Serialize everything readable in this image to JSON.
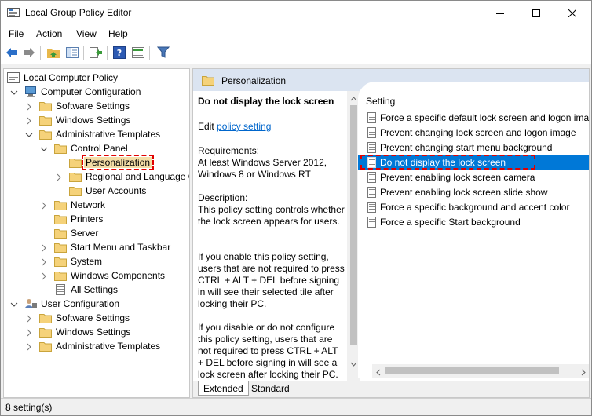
{
  "window": {
    "title": "Local Group Policy Editor",
    "controls": [
      "minimize-icon",
      "maximize-icon",
      "close-icon"
    ]
  },
  "menu": [
    "File",
    "Action",
    "View",
    "Help"
  ],
  "toolbar": {
    "icons": [
      "back-arrow-icon",
      "forward-arrow-icon",
      "up-folder-icon",
      "show-hide-tree-icon",
      "export-list-icon",
      "help-icon",
      "properties-icon",
      "filter-icon"
    ]
  },
  "tree": {
    "items": [
      {
        "label": "Local Computer Policy"
      },
      {
        "label": "Computer Configuration"
      },
      {
        "label": "Software Settings"
      },
      {
        "label": "Windows Settings"
      },
      {
        "label": "Administrative Templates"
      },
      {
        "label": "Control Panel"
      },
      {
        "label": "Personalization"
      },
      {
        "label": "Regional and Language Options"
      },
      {
        "label": "User Accounts"
      },
      {
        "label": "Network"
      },
      {
        "label": "Printers"
      },
      {
        "label": "Server"
      },
      {
        "label": "Start Menu and Taskbar"
      },
      {
        "label": "System"
      },
      {
        "label": "Windows Components"
      },
      {
        "label": "All Settings"
      },
      {
        "label": "User Configuration"
      },
      {
        "label": "Software Settings"
      },
      {
        "label": "Windows Settings"
      },
      {
        "label": "Administrative Templates"
      }
    ],
    "selected": "Personalization"
  },
  "right_pane": {
    "header": "Personalization",
    "description": {
      "title": "Do not display the lock screen",
      "edit_prefix": "Edit",
      "edit_link": "policy setting",
      "requirements_label": "Requirements:",
      "requirements": "At least Windows Server 2012, Windows 8 or Windows RT",
      "description_label": "Description:",
      "text1": "This policy setting controls whether the lock screen appears for users.",
      "text2": "If you enable this policy setting, users that are not required to press CTRL + ALT + DEL before signing in will see their selected tile after locking their PC.",
      "text3": "If you disable or do not configure this policy setting, users that are not required to press CTRL + ALT + DEL before signing in will see a lock screen after locking their PC."
    },
    "list_header": "Setting",
    "settings": [
      {
        "label": "Force a specific default lock screen and logon image"
      },
      {
        "label": "Prevent changing lock screen and logon image"
      },
      {
        "label": "Prevent changing start menu background"
      },
      {
        "label": "Do not display the lock screen"
      },
      {
        "label": "Prevent enabling lock screen camera"
      },
      {
        "label": "Prevent enabling lock screen slide show"
      },
      {
        "label": "Force a specific background and accent color"
      },
      {
        "label": "Force a specific Start background"
      }
    ],
    "selected_setting": "Do not display the lock screen",
    "tabs": [
      "Extended",
      "Standard"
    ],
    "active_tab": "Extended"
  },
  "status": {
    "text": "8 setting(s)"
  },
  "colors": {
    "selection_blue": "#0078d7",
    "header_band": "#dbe4f1",
    "annotation_red": "#e00000",
    "link_blue": "#0066cc"
  }
}
